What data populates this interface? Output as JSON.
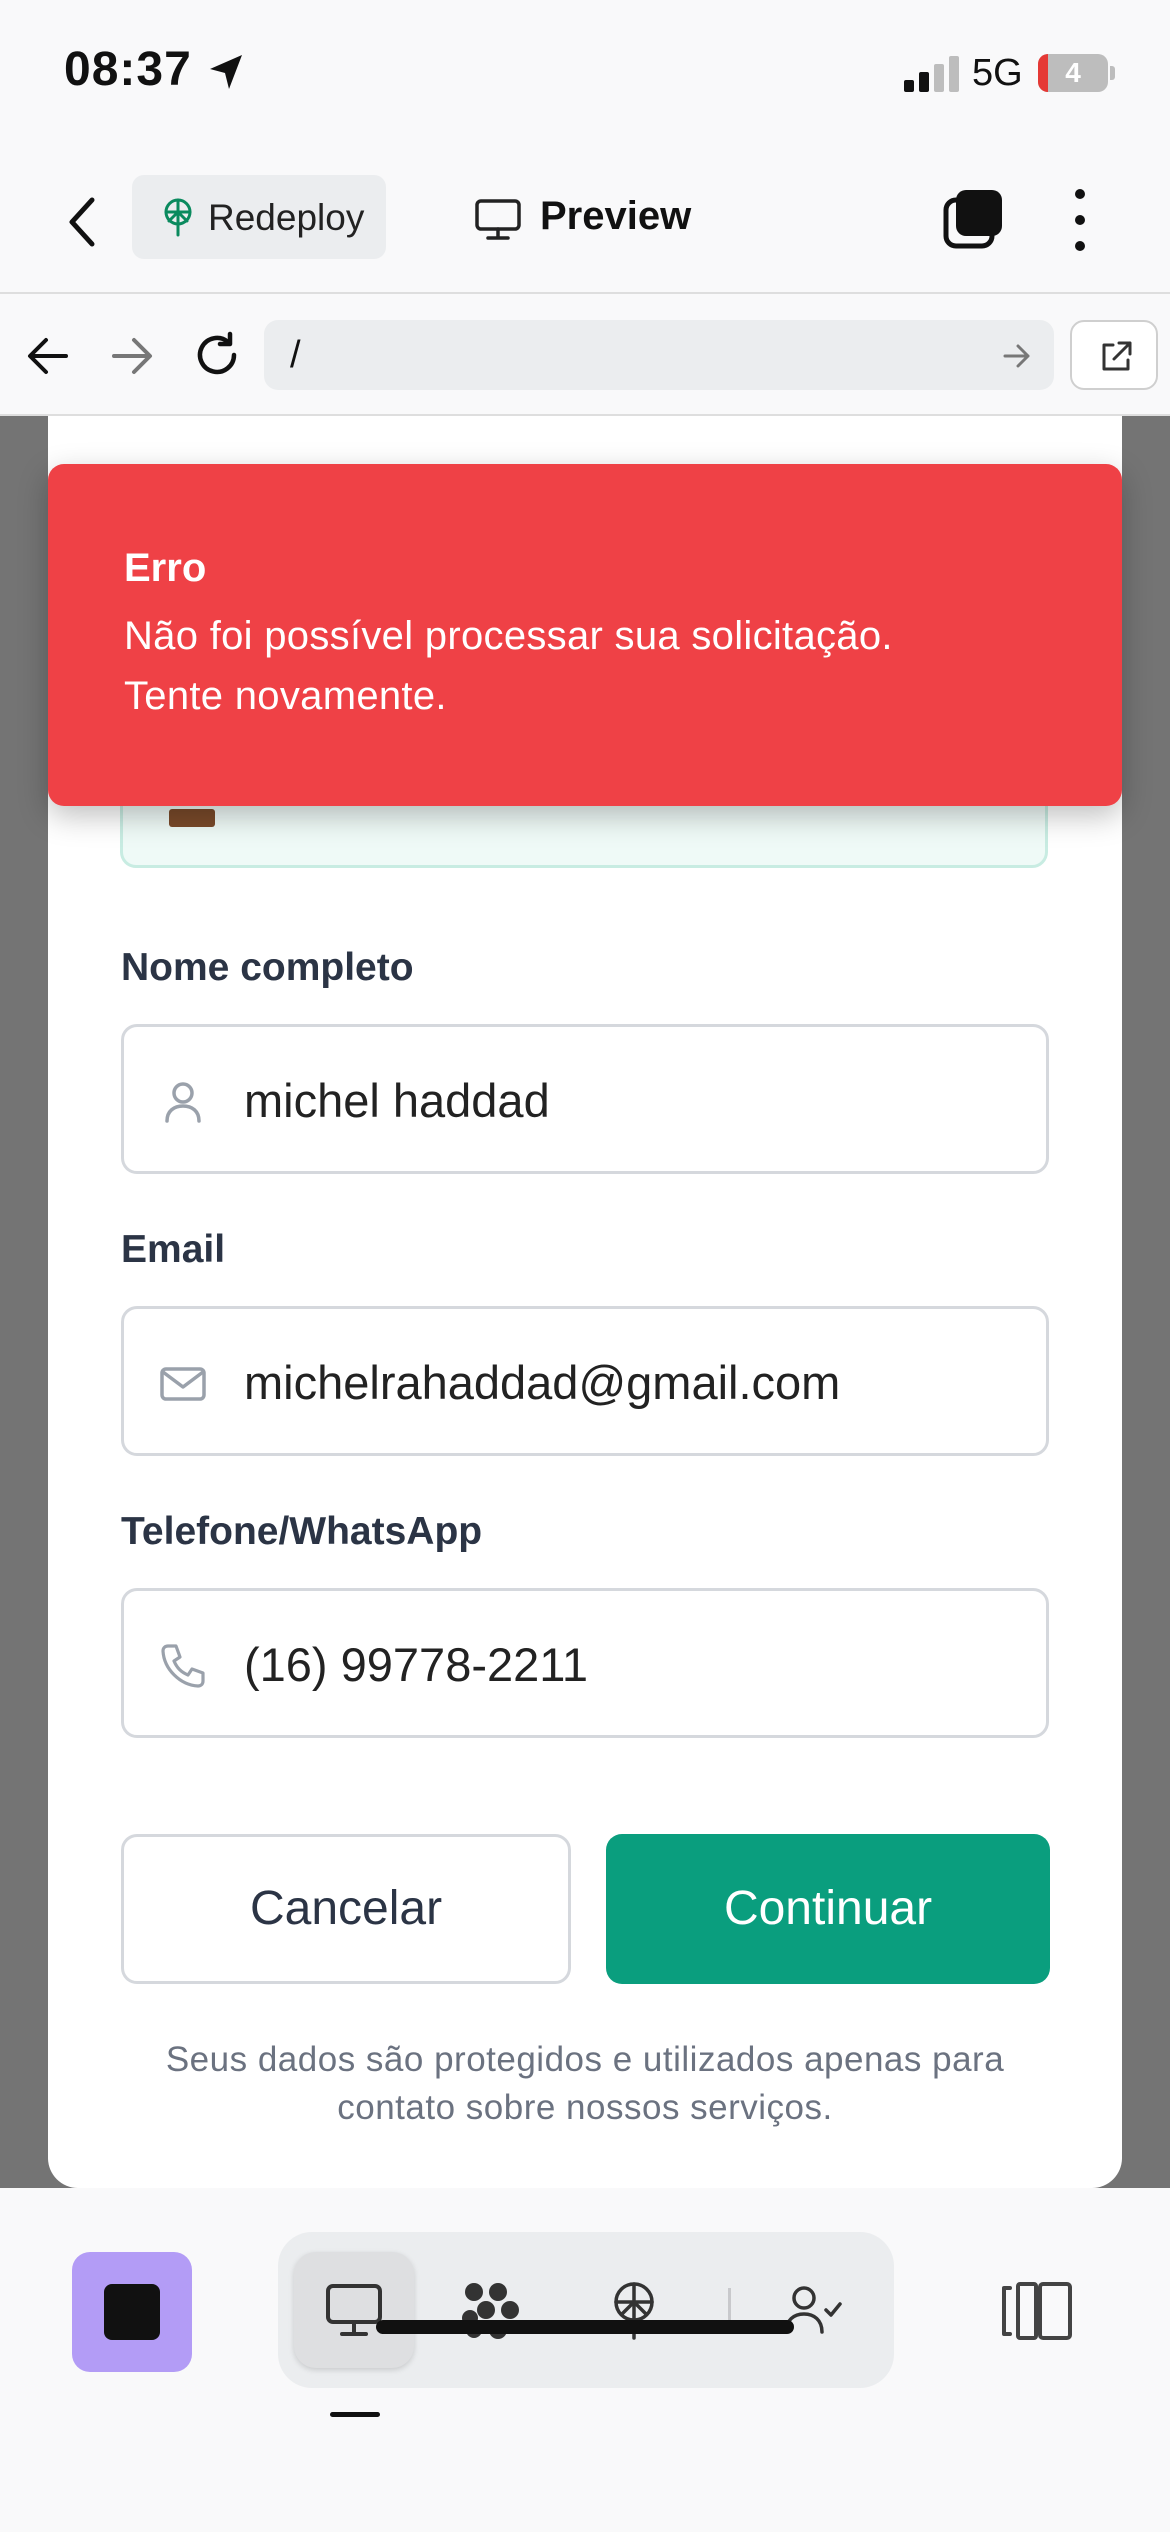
{
  "status_bar": {
    "time": "08:37",
    "network": "5G",
    "battery_level": "4",
    "battery_fraction": 0.04
  },
  "app_header": {
    "project_label": "Redeploy",
    "mode_label": "Preview"
  },
  "browser": {
    "url": "/"
  },
  "toast": {
    "title": "Erro",
    "message_line1": "Não foi possível processar sua solicitação.",
    "message_line2": "Tente novamente.",
    "background_color": "#ef4146"
  },
  "form": {
    "name_label": "Nome completo",
    "name_value": "michel haddad",
    "email_label": "Email",
    "email_value": "michelrahaddad@gmail.com",
    "phone_label": "Telefone/WhatsApp",
    "phone_value": "(16) 99778-2211",
    "cancel_label": "Cancelar",
    "continue_label": "Continuar",
    "privacy_line1": "Seus dados são protegidos e utilizados apenas para",
    "privacy_line2": "contato sobre nossos serviços.",
    "accent_color": "#0a9e7e"
  },
  "toolbar": {
    "items": [
      "stop-icon",
      "monitor-icon",
      "nodes-icon",
      "deploy-icon",
      "user-check-icon",
      "split-view-icon"
    ],
    "active_item": "monitor-icon",
    "stop_button_color": "#b39cf6"
  }
}
